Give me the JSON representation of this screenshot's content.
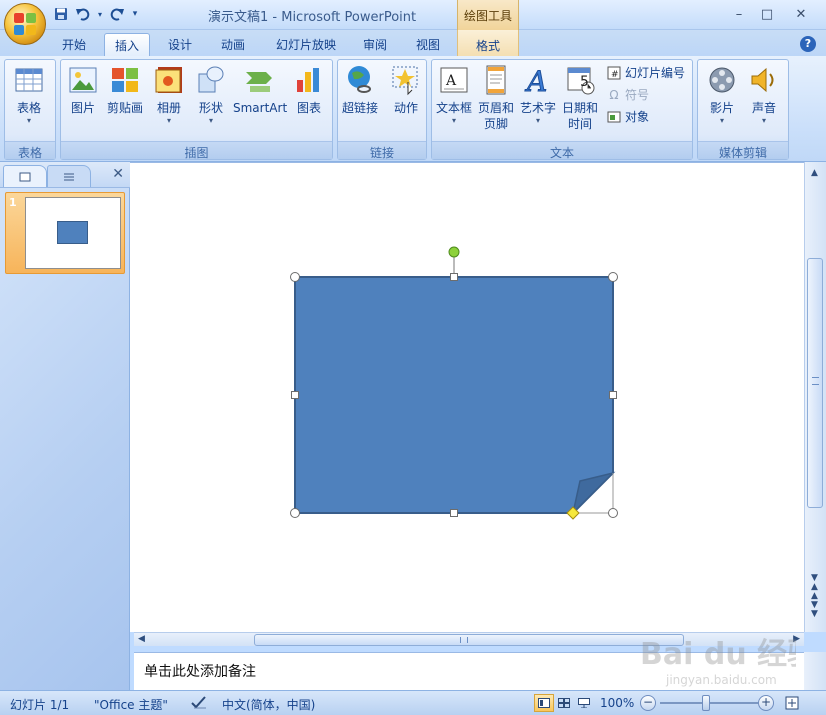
{
  "window": {
    "title": "演示文稿1 - Microsoft PowerPoint",
    "contextual_group": "绘图工具",
    "minimize_glyph": "–",
    "maximize_glyph": "□",
    "close_glyph": "✕"
  },
  "tabs": [
    {
      "label": "开始"
    },
    {
      "label": "插入"
    },
    {
      "label": "设计"
    },
    {
      "label": "动画"
    },
    {
      "label": "幻灯片放映"
    },
    {
      "label": "审阅"
    },
    {
      "label": "视图"
    },
    {
      "label": "格式"
    }
  ],
  "active_tab": "插入",
  "help_glyph": "?",
  "ribbon": {
    "groups": {
      "tables": "表格",
      "illustrations": "插图",
      "links": "链接",
      "text": "文本",
      "media": "媒体剪辑"
    },
    "buttons": {
      "table": "表格",
      "picture": "图片",
      "clipart": "剪贴画",
      "album": "相册",
      "shapes": "形状",
      "smartart": "SmartArt",
      "chart": "图表",
      "hyperlink": "超链接",
      "action": "动作",
      "textbox": "文本框",
      "header_footer_1": "页眉和",
      "header_footer_2": "页脚",
      "wordart": "艺术字",
      "datetime_1": "日期和",
      "datetime_2": "时间",
      "slide_number": "幻灯片编号",
      "symbol": "符号",
      "object": "对象",
      "movie": "影片",
      "sound": "声音"
    },
    "datetime_icon_number": "5"
  },
  "left_panel": {
    "close_glyph": "✕",
    "slide_number": "1"
  },
  "notes_placeholder": "单击此处添加备注",
  "status": {
    "slide": "幻灯片 1/1",
    "theme": "\"Office 主题\"",
    "language": "中文(简体，中国)",
    "zoom": "100%",
    "zoom_minus": "−",
    "zoom_plus": "+"
  },
  "colors": {
    "shape_fill": "#4f81bd",
    "shape_border": "#385d8a",
    "ribbon_text": "#15428b",
    "contextual_tab": "#f4dfb2"
  },
  "watermark": {
    "line1": "Bai du 经验",
    "line2": "jingyan.baidu.com"
  }
}
